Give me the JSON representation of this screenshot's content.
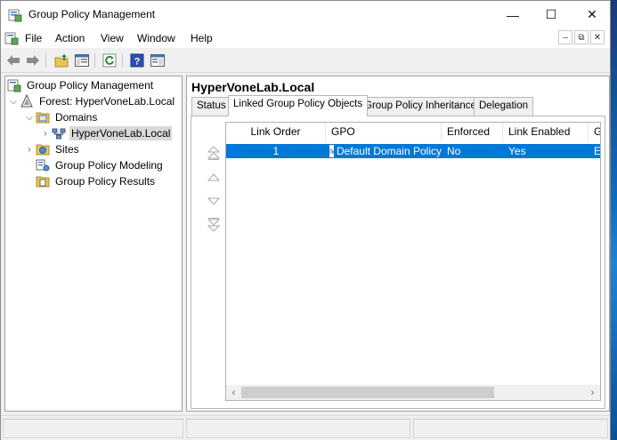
{
  "window": {
    "title": "Group Policy Management",
    "controls": {
      "minimize": "—",
      "maximize": "☐",
      "close": "✕"
    }
  },
  "menu": {
    "items": [
      "File",
      "Action",
      "View",
      "Window",
      "Help"
    ]
  },
  "toolbar": {
    "buttons": [
      "back-icon",
      "forward-icon",
      "up-folder-icon",
      "show-hide-tree-icon",
      "refresh-icon",
      "help-icon",
      "properties-icon"
    ]
  },
  "tree": {
    "root": "Group Policy Management",
    "forest": "Forest: HyperVoneLab.Local",
    "domains": "Domains",
    "domain": "HyperVoneLab.Local",
    "sites": "Sites",
    "modeling": "Group Policy Modeling",
    "results": "Group Policy Results"
  },
  "pane": {
    "title": "HyperVoneLab.Local",
    "tabs": [
      "Status",
      "Linked Group Policy Objects",
      "Group Policy Inheritance",
      "Delegation"
    ],
    "active_tab": "Linked Group Policy Objects"
  },
  "table": {
    "columns": [
      "Link Order",
      "GPO",
      "Enforced",
      "Link Enabled",
      "G"
    ],
    "rows": [
      {
        "link_order": "1",
        "gpo": "Default Domain Policy",
        "enforced": "No",
        "link_enabled": "Yes",
        "g": "E"
      }
    ]
  },
  "colors": {
    "selection": "#0078d7",
    "window_bg": "#f0f0f0"
  }
}
